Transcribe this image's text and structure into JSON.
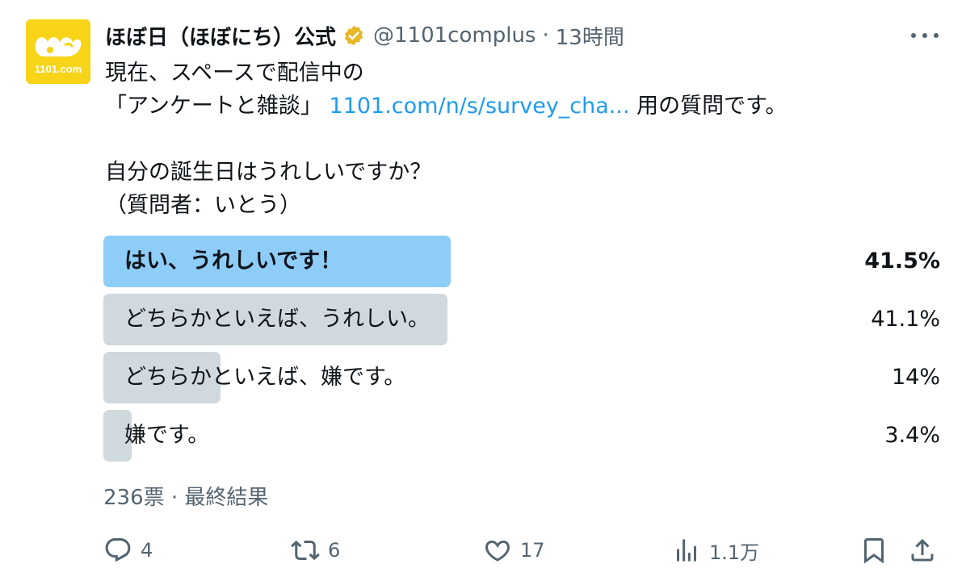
{
  "tweet": {
    "display_name": "ほぼ日（ほぼにち）公式",
    "handle": "@1101complus",
    "separator": "·",
    "time": "13時間",
    "avatar_text": "1101.com",
    "verified": true,
    "text": {
      "line1": "現在、スペースで配信中の",
      "line2_before": "「アンケートと雑談」 ",
      "line2_link": "1101.com/n/s/survey_cha...",
      "line2_after": " 用の質問です。",
      "line3": "自分の誕生日はうれしいですか？",
      "line4": "（質問者：いとう）"
    }
  },
  "poll": {
    "options": [
      {
        "label": "はい、うれしいです！",
        "percent_text": "41.5%",
        "percent": 41.5,
        "winner": true
      },
      {
        "label": "どちらかといえば、うれしい。",
        "percent_text": "41.1%",
        "percent": 41.1,
        "winner": false
      },
      {
        "label": "どちらかといえば、嫌です。",
        "percent_text": "14%",
        "percent": 14,
        "winner": false
      },
      {
        "label": "嫌です。",
        "percent_text": "3.4%",
        "percent": 3.4,
        "winner": false
      }
    ],
    "meta": "236票 · 最終結果"
  },
  "actions": {
    "replies": "4",
    "retweets": "6",
    "likes": "17",
    "views": "1.1万"
  },
  "colors": {
    "link": "#1d9bf0",
    "winner_bar": "#8ecdf8",
    "bar": "#cfd9de",
    "secondary_text": "#536471",
    "verified_badge": "#e8b829",
    "avatar_bg": "#f7d417"
  },
  "icons": {
    "avatar": "hobonichi-logo",
    "verified": "verified-badge-icon",
    "more": "more-icon",
    "reply": "reply-icon",
    "retweet": "retweet-icon",
    "like": "heart-icon",
    "views": "views-icon",
    "bookmark": "bookmark-icon",
    "share": "share-icon"
  }
}
